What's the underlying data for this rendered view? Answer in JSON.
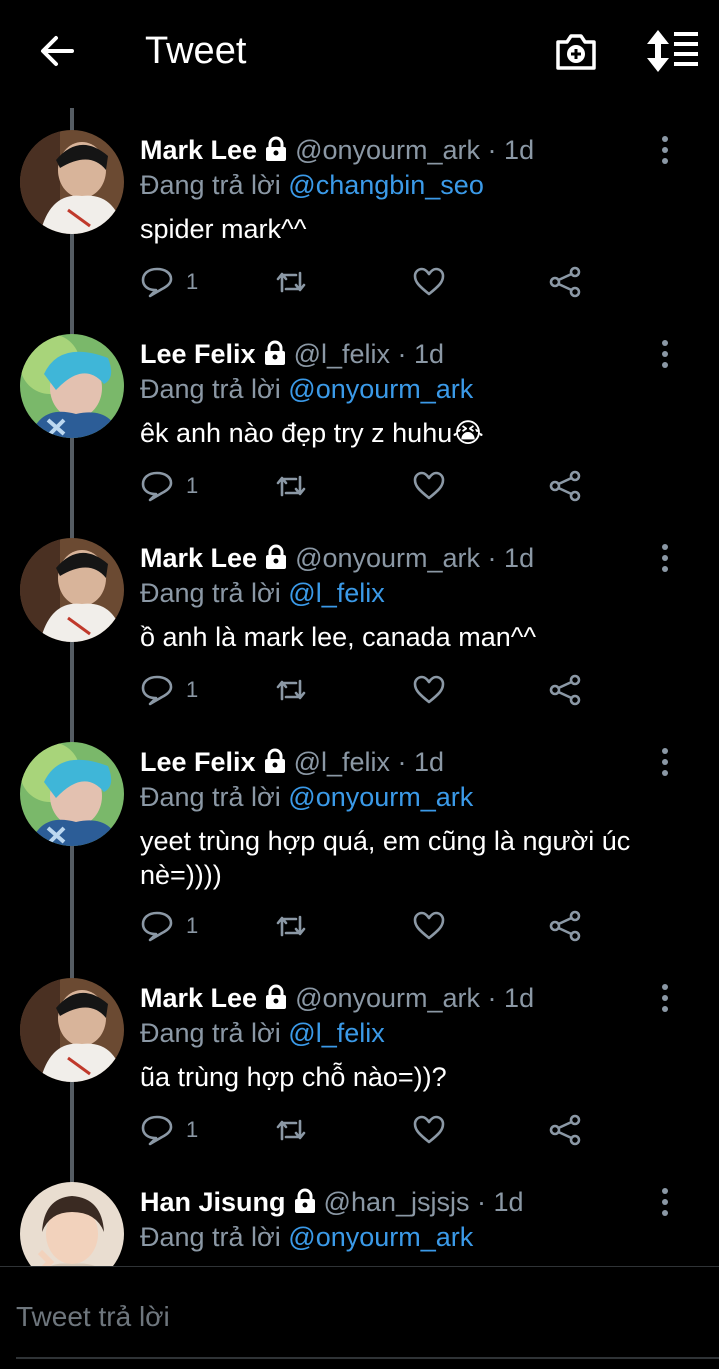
{
  "header": {
    "title": "Tweet"
  },
  "tweets": [
    {
      "name": "Mark Lee",
      "handle": "@onyourm_ark",
      "time": "1d",
      "reply_prefix": "Đang trả lời",
      "reply_to": "@changbin_seo",
      "text": "spider mark^^",
      "reply_count": "1",
      "avatar": "mark"
    },
    {
      "name": "Lee Felix",
      "handle": "@l_felix",
      "time": "1d",
      "reply_prefix": "Đang trả lời",
      "reply_to": "@onyourm_ark",
      "text": "êk anh nào đẹp try z huhu😭",
      "reply_count": "1",
      "avatar": "felix"
    },
    {
      "name": "Mark Lee",
      "handle": "@onyourm_ark",
      "time": "1d",
      "reply_prefix": "Đang trả lời",
      "reply_to": "@l_felix",
      "text": "ồ anh là mark lee, canada man^^",
      "reply_count": "1",
      "avatar": "mark"
    },
    {
      "name": "Lee Felix",
      "handle": "@l_felix",
      "time": "1d",
      "reply_prefix": "Đang trả lời",
      "reply_to": "@onyourm_ark",
      "text": "yeet trùng hợp quá, em cũng là người úc nè=))))",
      "reply_count": "1",
      "avatar": "felix"
    },
    {
      "name": "Mark Lee",
      "handle": "@onyourm_ark",
      "time": "1d",
      "reply_prefix": "Đang trả lời",
      "reply_to": "@l_felix",
      "text": "ũa trùng hợp chỗ nào=))?",
      "reply_count": "1",
      "avatar": "mark"
    },
    {
      "name": "Han Jisung",
      "handle": "@han_jsjsjs",
      "time": "1d",
      "reply_prefix": "Đang trả lời",
      "reply_to": "@onyourm_ark",
      "text": "",
      "reply_count": "",
      "avatar": "han"
    }
  ],
  "reply_bar": {
    "placeholder": "Tweet trả lời"
  },
  "colors": {
    "background": "#000000",
    "link": "#3b9ae8",
    "muted": "#8b98a5",
    "thread_line": "#555c63"
  },
  "icons": [
    "back-arrow-icon",
    "camera-plus-icon",
    "sort-icon",
    "lock-icon",
    "more-vertical-icon",
    "reply-icon",
    "retweet-icon",
    "like-icon",
    "share-icon"
  ]
}
